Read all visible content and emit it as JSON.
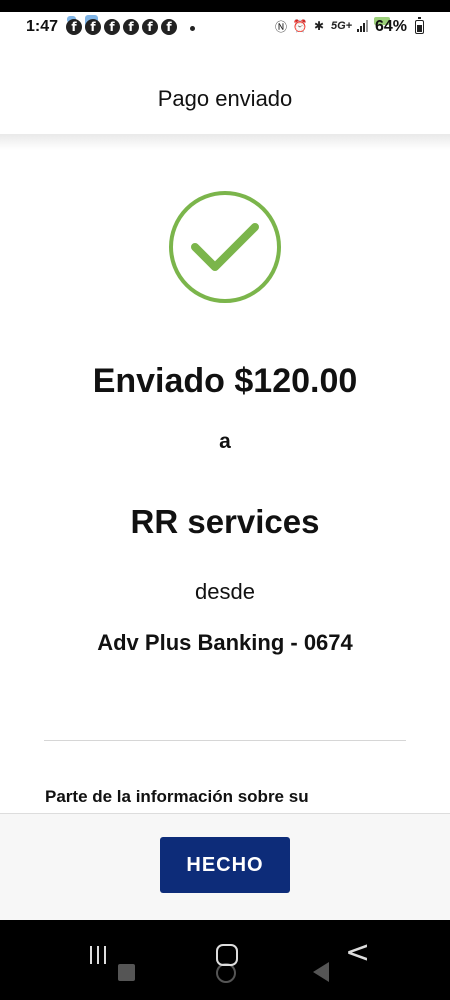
{
  "status_bar": {
    "time": "1:47",
    "network": "5G+",
    "battery": "64%",
    "notification_icons": [
      "facebook-icon",
      "facebook-icon",
      "facebook-icon",
      "facebook-icon",
      "facebook-icon",
      "facebook-icon"
    ],
    "system_icons": [
      "nfc-icon",
      "alarm-icon",
      "bluetooth-icon",
      "signal-icon",
      "battery-icon"
    ]
  },
  "header": {
    "title": "Pago enviado"
  },
  "confirmation": {
    "icon": "check-circle-icon",
    "accent_color": "#7bb54b",
    "amount_line": "Enviado $120.00",
    "to_label": "a",
    "payee": "RR services",
    "from_label": "desde",
    "account": "Adv Plus Banking - 0674",
    "info_text": "Parte de la información sobre su"
  },
  "footer": {
    "done_label": "HECHO",
    "button_color": "#0d2c79"
  },
  "nav": {
    "recents": "recents-icon",
    "home": "home-icon",
    "back": "back-icon"
  }
}
